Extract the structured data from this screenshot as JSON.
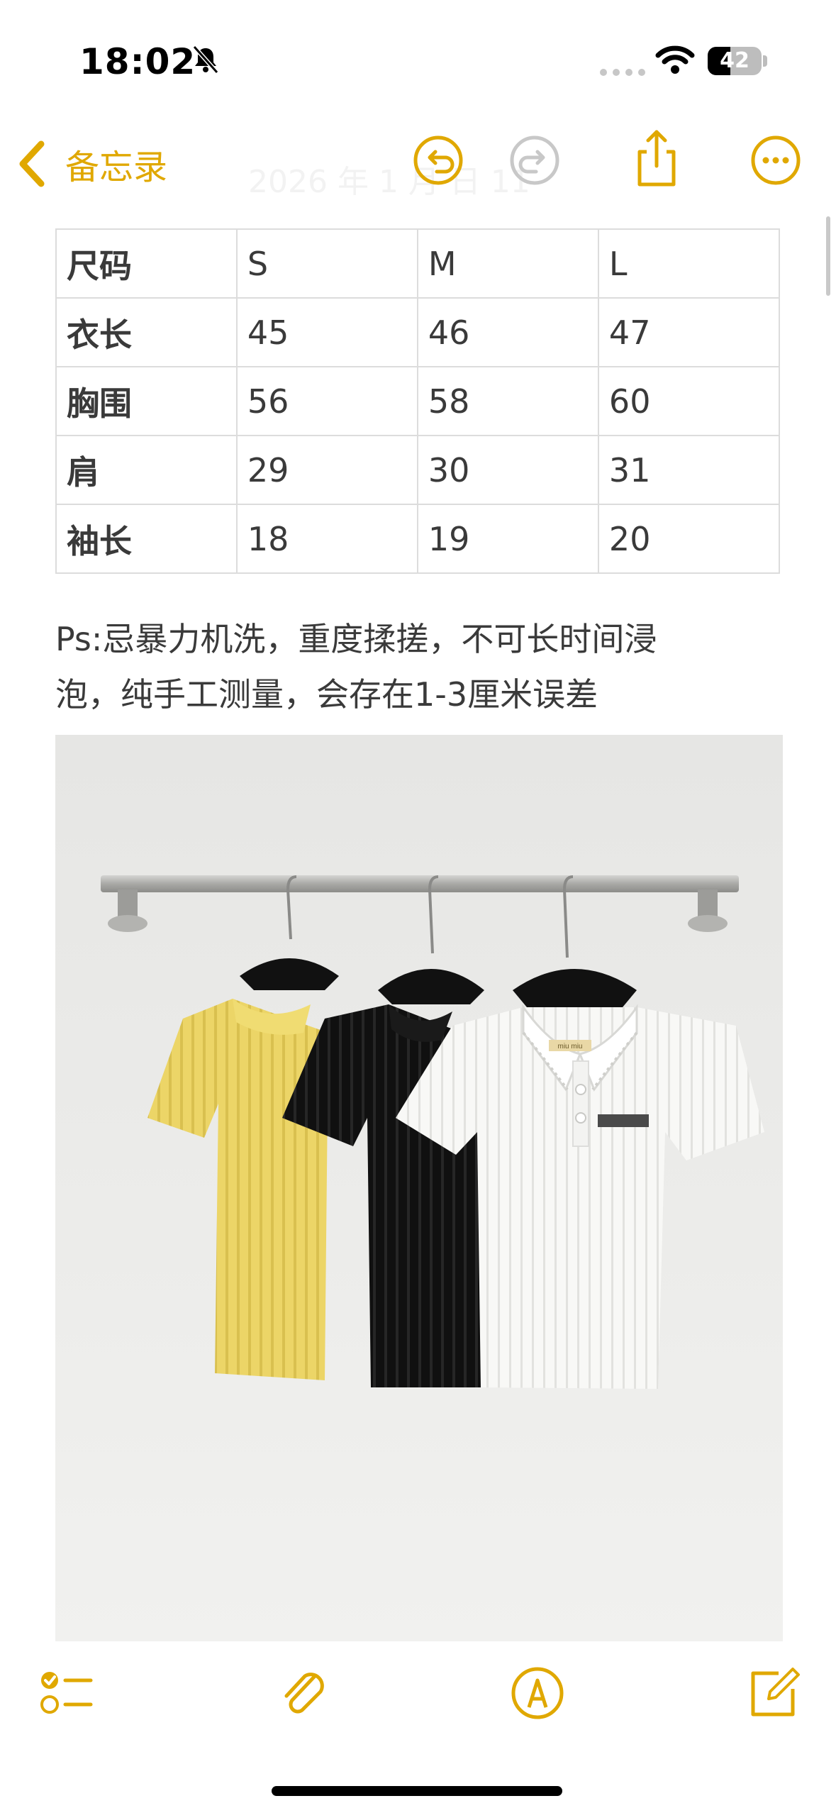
{
  "status_bar": {
    "time": "18:02",
    "battery": "42",
    "battery_level": 0.42
  },
  "nav": {
    "back_label": "备忘录",
    "faded_title": "2026 年 1 月 日 11"
  },
  "size_table": {
    "rows": [
      [
        "尺码",
        "S",
        "M",
        "L"
      ],
      [
        "衣长",
        "45",
        "46",
        "47"
      ],
      [
        "胸围",
        "56",
        "58",
        "60"
      ],
      [
        "肩",
        "29",
        "30",
        "31"
      ],
      [
        "袖长",
        "18",
        "19",
        "20"
      ]
    ]
  },
  "note": {
    "line1": "Ps:忌暴力机洗，重度揉搓，不可长时间浸",
    "line2": "泡，纯手工测量，会存在1-3厘米误差"
  },
  "photo": {
    "label_text": "miu miu"
  },
  "colors": {
    "accent": "#e0a800",
    "text": "#3a3a3a",
    "grid": "#dcdcdc"
  },
  "icons": [
    "bell-slash-icon",
    "wifi-icon",
    "battery-icon",
    "chevron-left-icon",
    "undo-icon",
    "redo-icon",
    "share-icon",
    "more-icon",
    "checklist-icon",
    "paperclip-icon",
    "markup-pen-icon",
    "compose-icon"
  ]
}
